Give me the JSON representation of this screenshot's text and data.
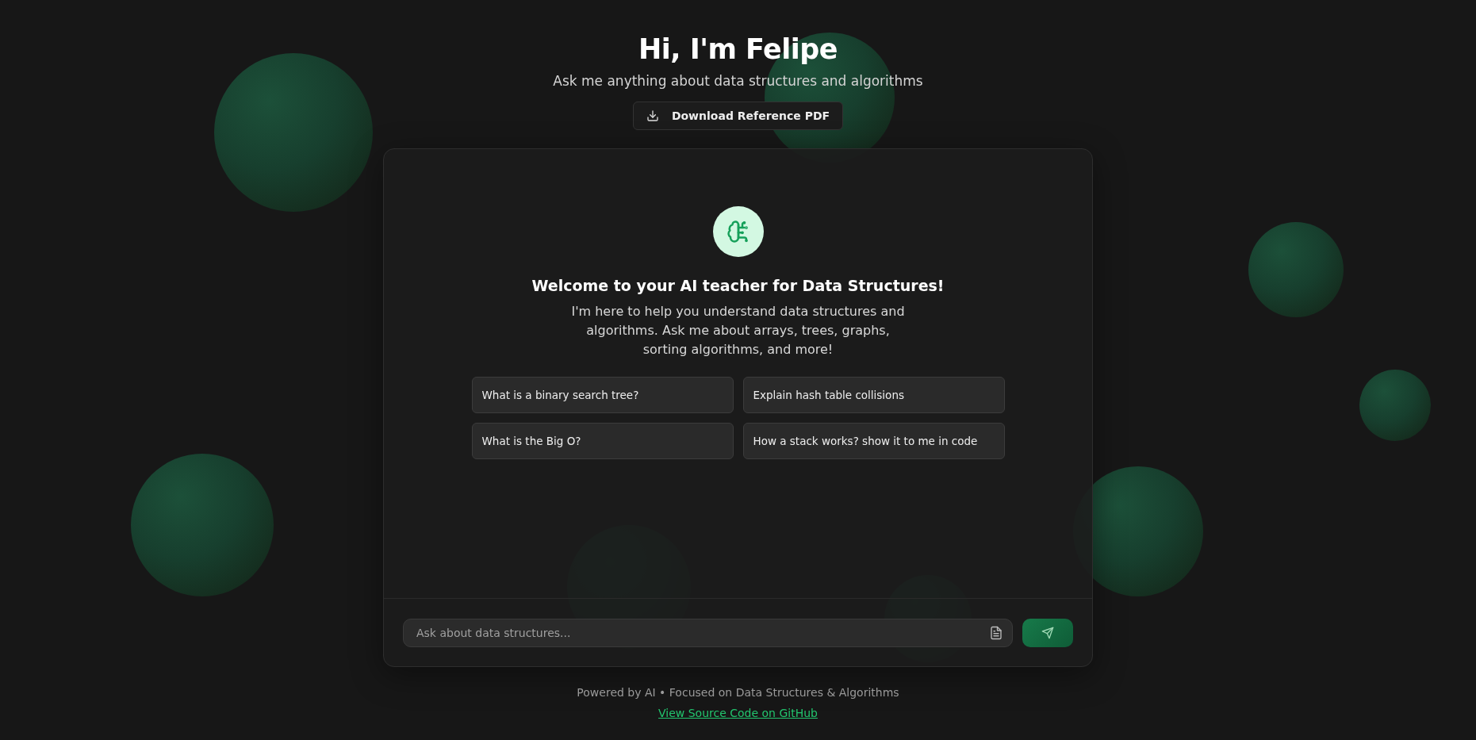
{
  "header": {
    "title": "Hi, I'm Felipe",
    "subtitle": "Ask me anything about data structures and algorithms",
    "download_button": "Download Reference PDF"
  },
  "chat": {
    "welcome_title": "Welcome to your AI teacher for Data Structures!",
    "welcome_text": "I'm here to help you understand data structures and algorithms. Ask me about arrays, trees, graphs, sorting algorithms, and more!",
    "suggestions": [
      "What is a binary search tree?",
      "Explain hash table collisions",
      "What is the Big O?",
      "How a stack works? show it to me in code"
    ],
    "input": {
      "placeholder": "Ask about data structures..."
    }
  },
  "footer": {
    "text": "Powered by AI • Focused on Data Structures & Algorithms",
    "link": "View Source Code on GitHub"
  }
}
